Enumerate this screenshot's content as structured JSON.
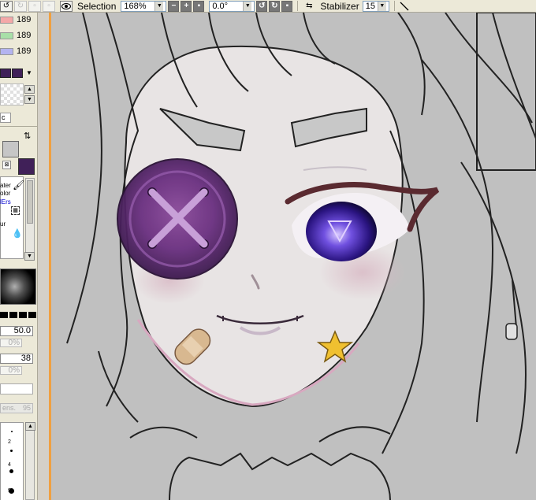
{
  "toolbar": {
    "selection_label": "Selection",
    "zoom_value": "168%",
    "rotation_value": "0.0°",
    "stabilizer_label": "Stabilizer",
    "stabilizer_value": "15"
  },
  "color_sliders": [
    {
      "value": "189",
      "color": "#f4a8a8"
    },
    {
      "value": "189",
      "color": "#a8e0a8"
    },
    {
      "value": "189",
      "color": "#b4b4f0"
    }
  ],
  "colors": {
    "primary": "#c6c6c6",
    "secondary": "#402058",
    "accent": "#f0a040"
  },
  "tool_panel": {
    "partial_label": "c",
    "water_label": "ater",
    "color_label": "olor",
    "ers_label": "lErs",
    "blur_label": "ur"
  },
  "brush_settings": {
    "size": "50.0",
    "min_size": "0%",
    "density": "38",
    "min_density": "0%",
    "strength_label": "ens.",
    "strength_value": "95"
  },
  "brush_sizes": [
    "2",
    "4",
    "9"
  ]
}
